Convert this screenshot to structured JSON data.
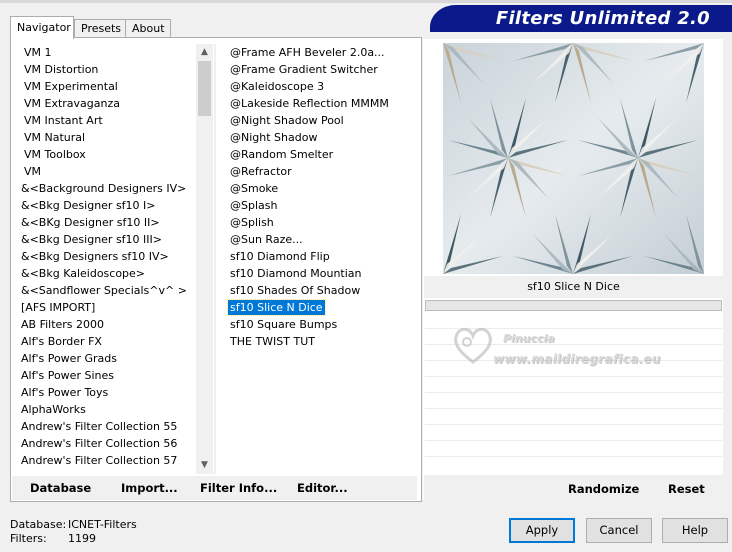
{
  "banner": {
    "title": "Filters Unlimited 2.0"
  },
  "tabs": [
    {
      "label": "Navigator",
      "active": true
    },
    {
      "label": "Presets",
      "active": false
    },
    {
      "label": "About",
      "active": false
    }
  ],
  "categories": [
    "VM 1",
    "VM Distortion",
    "VM Experimental",
    "VM Extravaganza",
    "VM Instant Art",
    "VM Natural",
    "VM Toolbox",
    "VM",
    "&<Background Designers IV>",
    "&<Bkg Designer sf10 I>",
    "&<BKg Designer sf10 II>",
    "&<Bkg Designer sf10 III>",
    "&<Bkg Designers sf10 IV>",
    "&<Bkg Kaleidoscope>",
    "&<Sandflower Specials^v^ >",
    "[AFS IMPORT]",
    "AB Filters 2000",
    "Alf's Border FX",
    "Alf's Power Grads",
    "Alf's Power Sines",
    "Alf's Power Toys",
    "AlphaWorks",
    "Andrew's Filter Collection 55",
    "Andrew's Filter Collection 56",
    "Andrew's Filter Collection 57"
  ],
  "filters": [
    "@Frame AFH Beveler 2.0a...",
    "@Frame Gradient Switcher",
    "@Kaleidoscope 3",
    "@Lakeside Reflection MMMM",
    "@Night Shadow Pool",
    "@Night Shadow",
    "@Random Smelter",
    "@Refractor",
    "@Smoke",
    "@Splash",
    "@Splish",
    "@Sun Raze...",
    "sf10 Diamond Flip",
    "sf10 Diamond Mountian",
    "sf10 Shades Of Shadow",
    "sf10 Slice N Dice",
    "sf10 Square Bumps",
    "THE TWIST TUT"
  ],
  "selected_filter_index": 15,
  "link_buttons": {
    "database": "Database",
    "import": "Import...",
    "filter_info": "Filter Info...",
    "editor": "Editor..."
  },
  "preview": {
    "filter_name": "sf10 Slice N Dice",
    "watermark_name": "Pinuccia",
    "watermark_url": "www.maildiregrafica.eu"
  },
  "right_buttons": {
    "randomize": "Randomize",
    "reset": "Reset"
  },
  "status": {
    "database_label": "Database:",
    "database_value": "ICNET-Filters",
    "filters_label": "Filters:",
    "filters_value": "1199"
  },
  "dialog": {
    "apply": "Apply",
    "cancel": "Cancel",
    "help": "Help"
  },
  "icons": {
    "scroll_up": "chevron-up-icon",
    "scroll_down": "chevron-down-icon",
    "watermark": "heart-logo-icon"
  },
  "colors": {
    "banner": "#0b1a8a",
    "selection": "#0078d7"
  }
}
